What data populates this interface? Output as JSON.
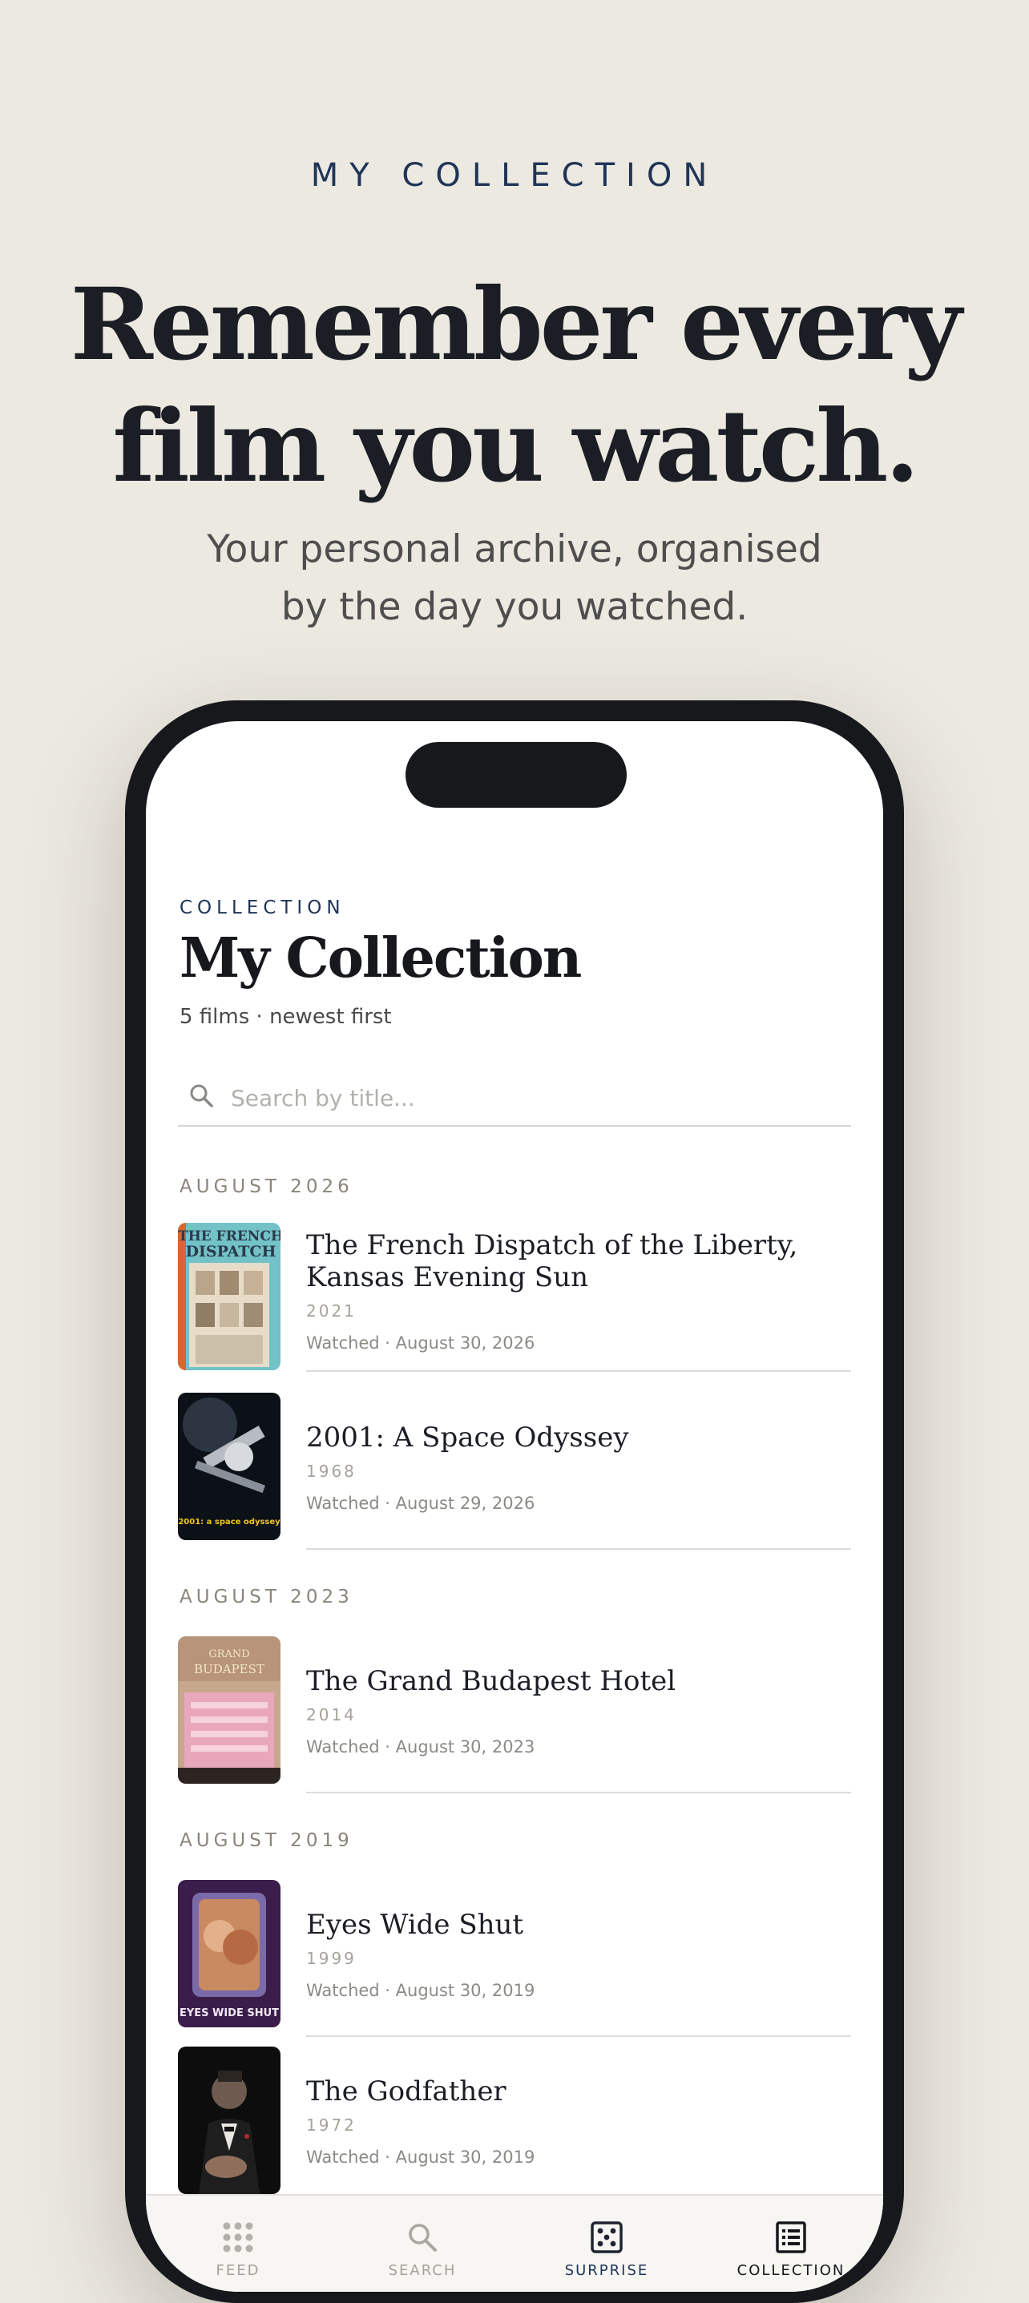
{
  "hero": {
    "eyebrow": "MY COLLECTION",
    "headline_line1": "Remember every",
    "headline_line2": "film you watch.",
    "subline_line1": "Your personal archive, organised",
    "subline_line2": "by the day you watched."
  },
  "screen": {
    "section_eyebrow": "COLLECTION",
    "title": "My Collection",
    "subtitle": "5 films · newest first",
    "search": {
      "placeholder": "Search by title...",
      "value": ""
    },
    "groups": [
      {
        "month": "AUGUST 2026",
        "films": [
          {
            "title": "The French Dispatch of the Liberty, Kansas Evening Sun",
            "year": "2021",
            "watched": "Watched · August 30, 2026",
            "poster_text": "THE FRENCH DISPATCH"
          },
          {
            "title": "2001: A Space Odyssey",
            "year": "1968",
            "watched": "Watched · August 29, 2026",
            "poster_text": "2001: a space odyssey"
          }
        ]
      },
      {
        "month": "AUGUST 2023",
        "films": [
          {
            "title": "The Grand Budapest Hotel",
            "year": "2014",
            "watched": "Watched · August 30, 2023",
            "poster_text": "GRAND BUDAPEST"
          }
        ]
      },
      {
        "month": "AUGUST 2019",
        "films": [
          {
            "title": "Eyes Wide Shut",
            "year": "1999",
            "watched": "Watched · August 30, 2019",
            "poster_text": "EYES WIDE SHUT"
          },
          {
            "title": "The Godfather",
            "year": "1972",
            "watched": "Watched · August 30, 2019",
            "poster_text": ""
          }
        ]
      }
    ]
  },
  "tabs": [
    {
      "label": "FEED",
      "icon": "grid-dots-icon",
      "active": false
    },
    {
      "label": "SEARCH",
      "icon": "search-icon",
      "active": false
    },
    {
      "label": "SURPRISE",
      "icon": "dice-icon",
      "active": true
    },
    {
      "label": "COLLECTION",
      "icon": "list-icon",
      "active": true
    }
  ],
  "colors": {
    "background": "#ece9e1",
    "accent_navy": "#1f3457",
    "ink": "#1b1e24",
    "phone_frame": "#16181c"
  }
}
